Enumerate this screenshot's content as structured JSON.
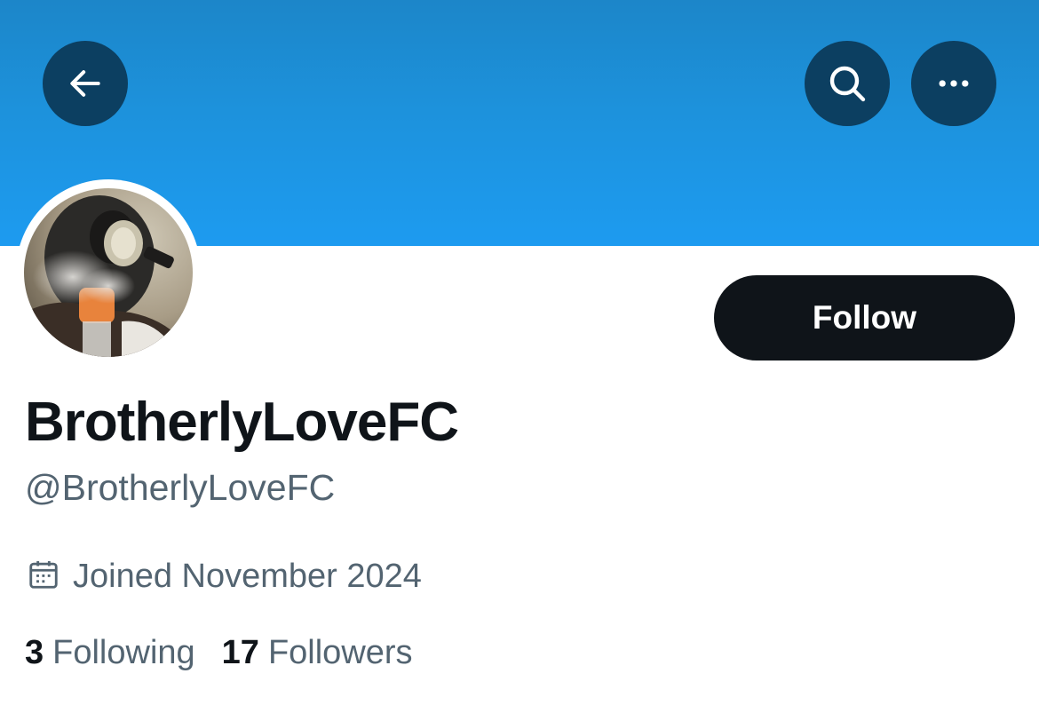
{
  "header": {
    "back_icon": "arrow-left-icon",
    "search_icon": "search-icon",
    "more_icon": "more-horizontal-icon",
    "banner_color": "#1d9bf0",
    "button_color": "#0c3f61"
  },
  "profile": {
    "display_name": "BrotherlyLoveFC",
    "handle": "@BrotherlyLoveFC",
    "joined": "Joined November 2024",
    "joined_icon": "calendar-icon",
    "follow_label": "Follow"
  },
  "stats": {
    "following_count": "3",
    "following_label": "Following",
    "followers_count": "17",
    "followers_label": "Followers"
  },
  "colors": {
    "text_primary": "#0f1419",
    "text_secondary": "#536471",
    "follow_button": "#0f1419"
  }
}
